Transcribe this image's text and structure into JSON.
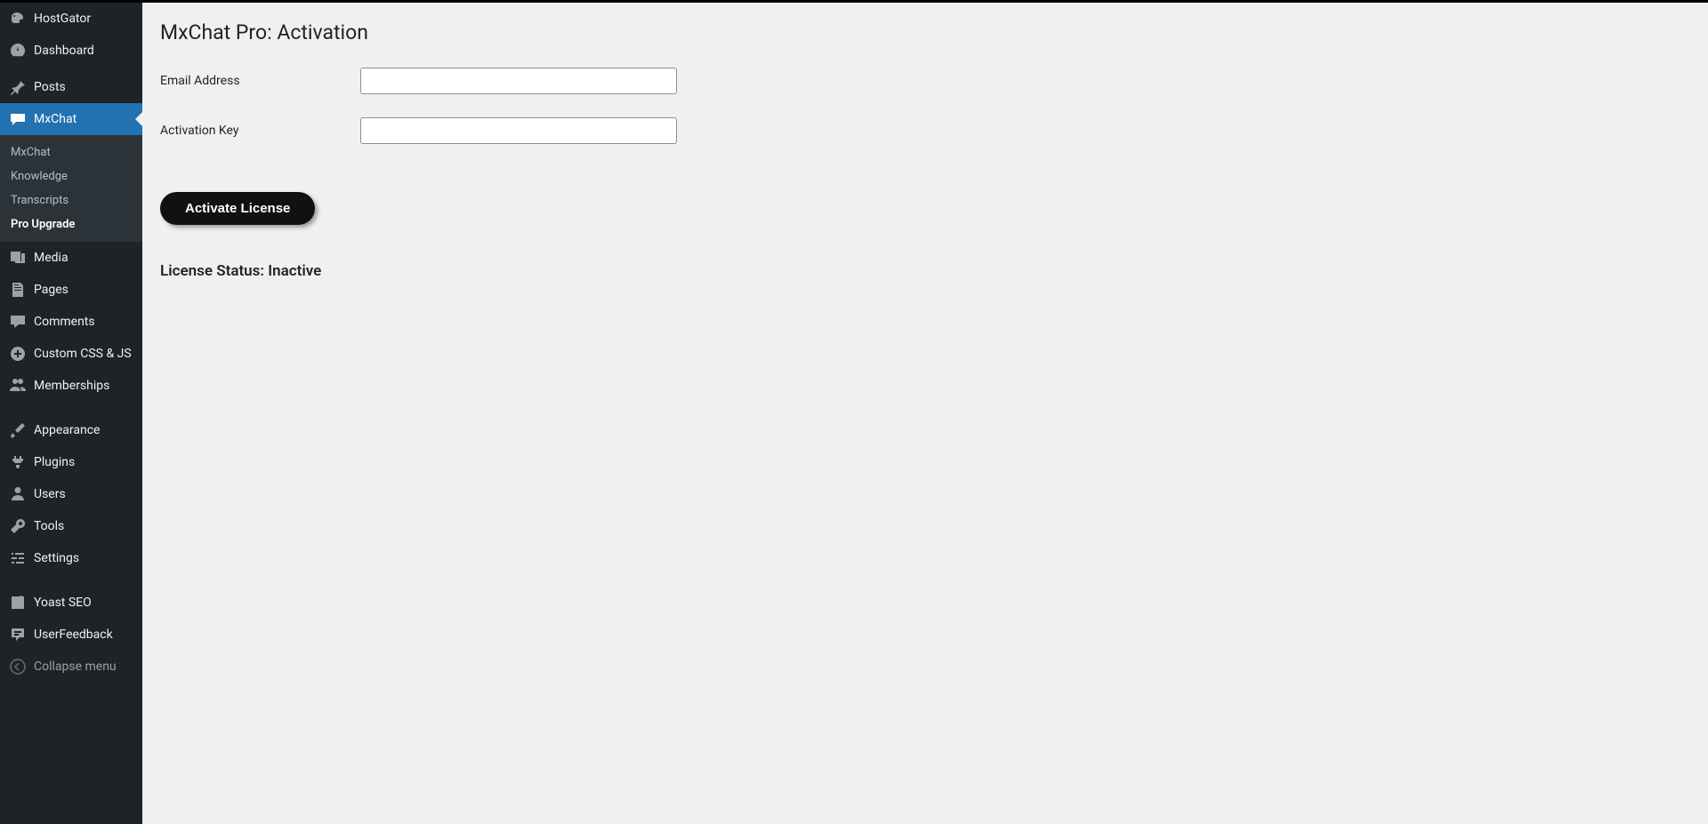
{
  "sidebar": {
    "items": [
      {
        "label": "HostGator",
        "icon": "hostgator"
      },
      {
        "label": "Dashboard",
        "icon": "dashboard"
      },
      {
        "label": "Posts",
        "icon": "pin"
      },
      {
        "label": "MxChat",
        "icon": "chat",
        "active": true
      },
      {
        "label": "Media",
        "icon": "media"
      },
      {
        "label": "Pages",
        "icon": "pages"
      },
      {
        "label": "Comments",
        "icon": "comment"
      },
      {
        "label": "Custom CSS & JS",
        "icon": "plus-circle"
      },
      {
        "label": "Memberships",
        "icon": "people"
      },
      {
        "label": "Appearance",
        "icon": "brush"
      },
      {
        "label": "Plugins",
        "icon": "plug"
      },
      {
        "label": "Users",
        "icon": "user"
      },
      {
        "label": "Tools",
        "icon": "wrench"
      },
      {
        "label": "Settings",
        "icon": "settings"
      },
      {
        "label": "Yoast SEO",
        "icon": "yoast"
      },
      {
        "label": "UserFeedback",
        "icon": "feedback"
      },
      {
        "label": "Collapse menu",
        "icon": "collapse"
      }
    ],
    "submenu": [
      {
        "label": "MxChat"
      },
      {
        "label": "Knowledge"
      },
      {
        "label": "Transcripts"
      },
      {
        "label": "Pro Upgrade",
        "current": true
      }
    ]
  },
  "page": {
    "title": "MxChat Pro: Activation",
    "email_label": "Email Address",
    "key_label": "Activation Key",
    "email_value": "",
    "key_value": "",
    "activate_button": "Activate License",
    "license_status_label": "License Status:",
    "license_status_value": "Inactive"
  }
}
